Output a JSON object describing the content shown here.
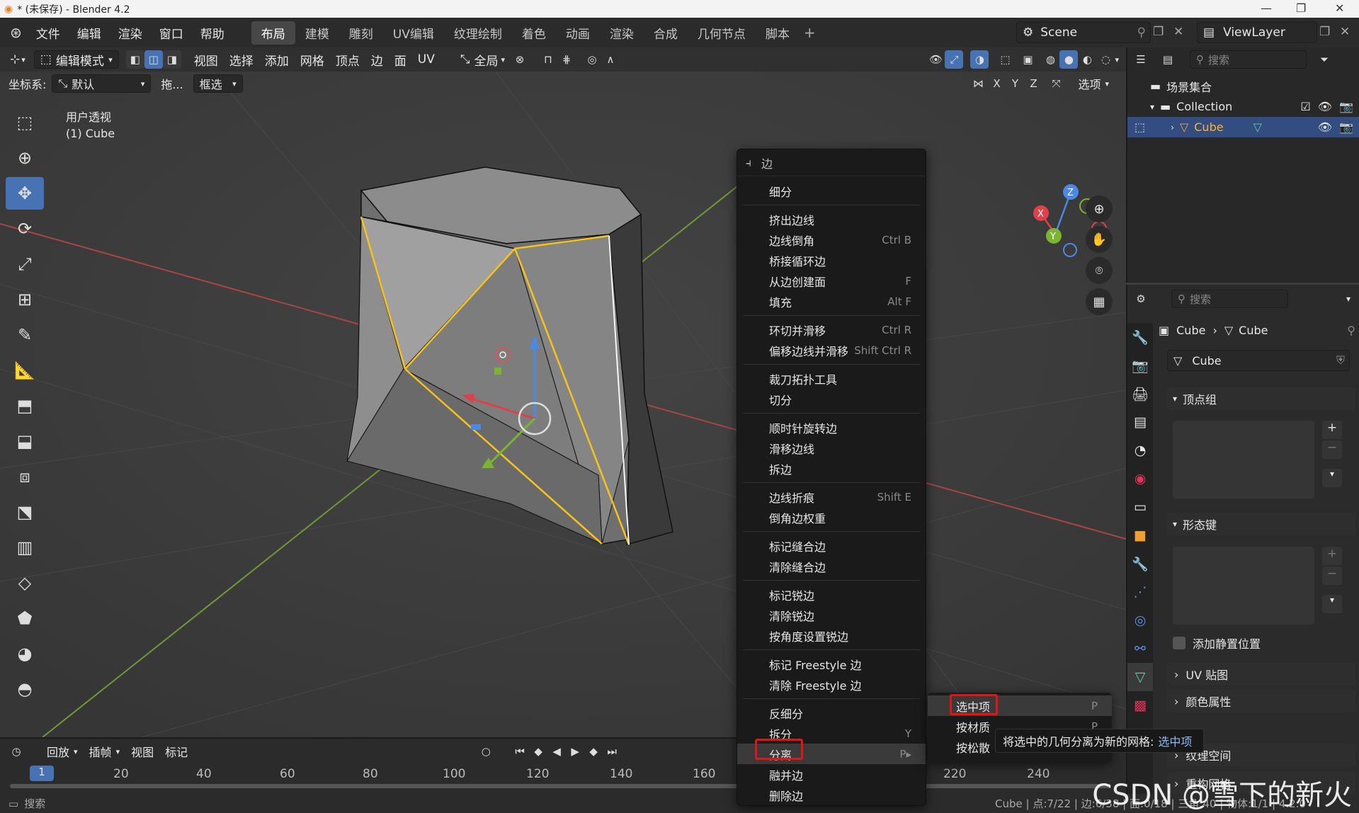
{
  "window": {
    "title": "* (未保存) - Blender 4.2"
  },
  "menubar": {
    "menus": [
      "文件",
      "编辑",
      "渲染",
      "窗口",
      "帮助"
    ],
    "workspaces": [
      "布局",
      "建模",
      "雕刻",
      "UV编辑",
      "纹理绘制",
      "着色",
      "动画",
      "渲染",
      "合成",
      "几何节点",
      "脚本"
    ],
    "active_workspace": "布局",
    "scene": "Scene",
    "viewlayer": "ViewLayer"
  },
  "header": {
    "mode": "编辑模式",
    "menus": [
      "视图",
      "选择",
      "添加",
      "网格",
      "顶点",
      "边",
      "面",
      "UV"
    ],
    "transform_orientation": "全局",
    "coord_label": "坐标系:",
    "coord_value": "默认",
    "drag_label": "拖...",
    "select_mode": "框选",
    "axes": [
      "X",
      "Y",
      "Z"
    ],
    "options": "选项"
  },
  "viewport": {
    "view_name": "用户透视",
    "object_label": "(1) Cube"
  },
  "outliner": {
    "search_placeholder": "搜索",
    "scene_collection": "场景集合",
    "collection": "Collection",
    "object": "Cube"
  },
  "properties": {
    "search_placeholder": "搜索",
    "breadcrumb_object": "Cube",
    "breadcrumb_mesh": "Cube",
    "mesh_name": "Cube",
    "sections": {
      "vertex_groups": "顶点组",
      "shape_keys": "形态键",
      "add_rest_position": "添加静置位置",
      "uv_maps": "UV 贴图",
      "color_attributes": "颜色属性",
      "texture_space": "纹理空间",
      "remesh": "重构网格"
    }
  },
  "context_menu": {
    "title": "边",
    "items": [
      {
        "label": "细分",
        "shortcut": ""
      },
      {
        "sep": true
      },
      {
        "label": "挤出边线",
        "shortcut": ""
      },
      {
        "label": "边线倒角",
        "shortcut": "Ctrl B"
      },
      {
        "label": "桥接循环边",
        "shortcut": ""
      },
      {
        "label": "从边创建面",
        "shortcut": "F"
      },
      {
        "label": "填充",
        "shortcut": "Alt F"
      },
      {
        "sep": true
      },
      {
        "label": "环切并滑移",
        "shortcut": "Ctrl R"
      },
      {
        "label": "偏移边线并滑移",
        "shortcut": "Shift Ctrl R"
      },
      {
        "sep": true
      },
      {
        "label": "裁刀拓扑工具",
        "shortcut": ""
      },
      {
        "label": "切分",
        "shortcut": ""
      },
      {
        "sep": true
      },
      {
        "label": "顺时针旋转边",
        "shortcut": ""
      },
      {
        "label": "滑移边线",
        "shortcut": ""
      },
      {
        "label": "拆边",
        "shortcut": ""
      },
      {
        "sep": true
      },
      {
        "label": "边线折痕",
        "shortcut": "Shift E"
      },
      {
        "label": "倒角边权重",
        "shortcut": ""
      },
      {
        "sep": true
      },
      {
        "label": "标记缝合边",
        "shortcut": ""
      },
      {
        "label": "清除缝合边",
        "shortcut": ""
      },
      {
        "sep": true
      },
      {
        "label": "标记锐边",
        "shortcut": ""
      },
      {
        "label": "清除锐边",
        "shortcut": ""
      },
      {
        "label": "按角度设置锐边",
        "shortcut": ""
      },
      {
        "sep": true
      },
      {
        "label": "标记 Freestyle 边",
        "shortcut": ""
      },
      {
        "label": "清除 Freestyle 边",
        "shortcut": ""
      },
      {
        "sep": true
      },
      {
        "label": "反细分",
        "shortcut": ""
      },
      {
        "label": "拆分",
        "shortcut": "Y"
      },
      {
        "label": "分离",
        "shortcut": "P▸",
        "highlight": true
      },
      {
        "label": "融并边",
        "shortcut": ""
      },
      {
        "label": "删除边",
        "shortcut": ""
      }
    ]
  },
  "submenu": {
    "items": [
      {
        "label": "选中项",
        "shortcut": "P"
      },
      {
        "label": "按材质",
        "shortcut": "P"
      },
      {
        "label": "按松散",
        "shortcut": ""
      }
    ]
  },
  "tooltip": {
    "text": "将选中的几何分离为新的网格:",
    "hint": "选中项"
  },
  "timeline": {
    "menus": [
      "回放",
      "插帧",
      "视图",
      "标记"
    ],
    "current_frame": "1",
    "frame_ticks": [
      "20",
      "40",
      "60",
      "80",
      "100",
      "120",
      "140",
      "160",
      "220",
      "240"
    ]
  },
  "statusbar": {
    "search": "搜索",
    "info": "Cube | 点:7/22 | 边:6/38 | 面:0/18 | 三角:40 | 物体:1/1 | 4.2.0"
  },
  "watermark": "CSDN @雪下的新火",
  "colors": {
    "accent": "#4772b3",
    "selected_edge": "#f7c31a",
    "highlight_box": "#e21414",
    "x_axis": "#e0404a",
    "y_axis": "#7bb430",
    "z_axis": "#3a8ae0"
  }
}
